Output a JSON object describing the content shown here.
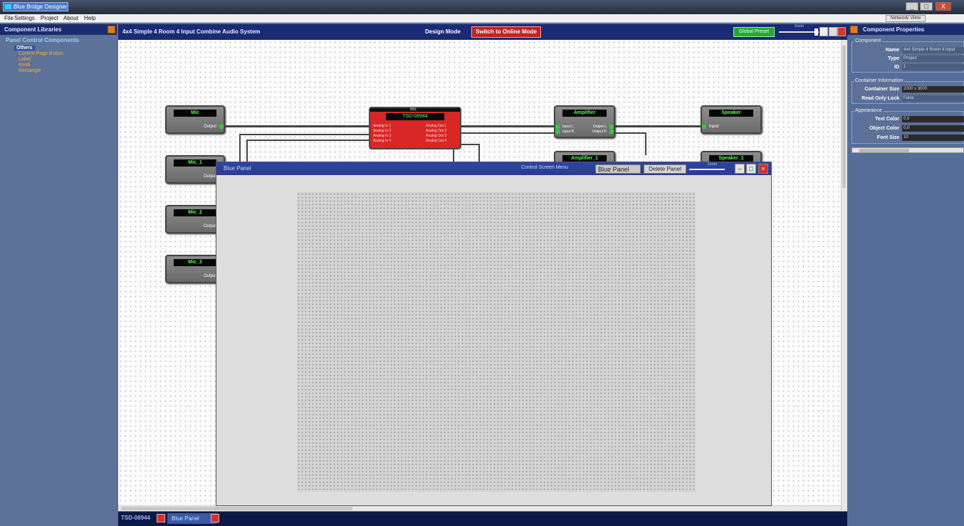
{
  "app": {
    "title": "Blue Bridge Designer"
  },
  "window": {
    "minimize": "_",
    "maximize": "□",
    "close": "X"
  },
  "menubar": {
    "items": [
      "File",
      "Settings",
      "Project",
      "About",
      "Help"
    ],
    "network_button": "Network View"
  },
  "left_panel": {
    "title": "Component Libraries",
    "group": "Panel Control Components",
    "selected": "Others",
    "items": [
      "Control Page Button",
      "Label",
      "Knob",
      "Rectangle"
    ]
  },
  "design": {
    "title": "4x4 Simple 4 Room 4 Input Combine Audio System",
    "mode": "Design Mode",
    "online_button": "Switch to Online Mode",
    "green_button": "Global Preset",
    "zoom_label": "Zoom"
  },
  "components": {
    "mic": {
      "label": "Mic",
      "port": "Output"
    },
    "mic1": {
      "label": "Mic_1",
      "port": "Output"
    },
    "mic2": {
      "label": "Mic_2",
      "port": "Output"
    },
    "mic3": {
      "label": "Mic_3",
      "port": "Output"
    },
    "tsd": {
      "top": "BBL",
      "label": "TSD-08944",
      "inputs": [
        "Analog In 1",
        "Analog In 2",
        "Analog In 3",
        "Analog In 4"
      ],
      "outputs": [
        "Analog Out 1",
        "Analog Out 2",
        "Analog Out 3",
        "Analog Out 4"
      ]
    },
    "amplifier": {
      "label": "Amplifier",
      "in1": "Input L",
      "in2": "Input R",
      "out1": "Output L",
      "out2": "Output R"
    },
    "amplifier1": {
      "label": "Amplifier_1"
    },
    "speaker": {
      "label": "Speaker",
      "port": "Input"
    },
    "speaker1": {
      "label": "Speaker_1"
    }
  },
  "blue_panel": {
    "title": "Blue Panel",
    "control_screen": "Control Screen Menu",
    "name_value": "Blue Panel",
    "delete_button": "Delete Panel",
    "zoom_label": "Zoom"
  },
  "bottom_tabs": [
    {
      "label": "TSD-08944"
    },
    {
      "label": "Blue Panel"
    }
  ],
  "right_panel": {
    "title": "Component Properties",
    "component_group": "Component",
    "name_label": "Name",
    "name_value": "4x4 Simple 4 Room 4 Input",
    "type_label": "Type",
    "type_value": "Project",
    "id_label": "ID",
    "id_value": "1",
    "container_group": "Container Information",
    "container_size_label": "Container Size",
    "container_size_value": "2000 x 3000",
    "readonly_label": "Read Only Lock",
    "readonly_value": "False",
    "appearance_group": "Appearance",
    "text_color_label": "Text Color",
    "text_color_value": "0,0",
    "object_color_label": "Object Color",
    "object_color_value": "0,0",
    "font_size_label": "Font Size",
    "font_size_value": "10"
  },
  "colors": {
    "accent": "#1b2a75",
    "tsd_red": "#d92626",
    "green_port": "#36c93a",
    "label_green": "#4dff4d"
  }
}
